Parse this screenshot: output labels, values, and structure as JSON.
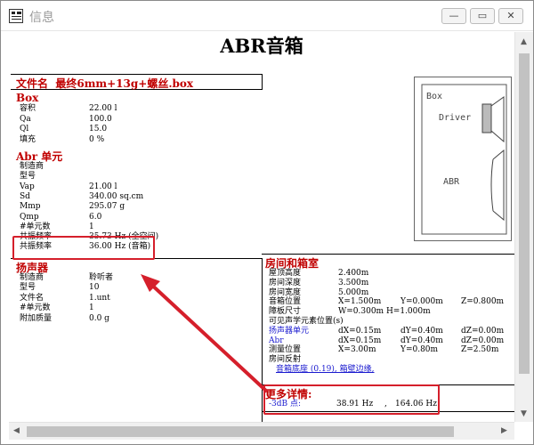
{
  "window": {
    "title": "信息"
  },
  "window_buttons": {
    "minimize": "—",
    "maximize": "▭",
    "close": "✕"
  },
  "doc": {
    "title": "ABR音箱"
  },
  "file": {
    "label": "文件名",
    "value": "最终6mm+13g+螺丝.box"
  },
  "box": {
    "heading": "Box",
    "rows": [
      {
        "label": "容积",
        "value": "22.00 l"
      },
      {
        "label": "Qa",
        "value": "100.0"
      },
      {
        "label": "Ql",
        "value": "15.0"
      },
      {
        "label": "填充",
        "value": "0 %"
      }
    ]
  },
  "abr": {
    "heading": "Abr 单元",
    "rows": [
      {
        "label": "制造商",
        "value": ""
      },
      {
        "label": "型号",
        "value": ""
      },
      {
        "label": "Vap",
        "value": "21.00 l"
      },
      {
        "label": "Sd",
        "value": "340.00 sq.cm"
      },
      {
        "label": "Mmp",
        "value": "295.07 g"
      },
      {
        "label": "Qmp",
        "value": "6.0"
      },
      {
        "label": "#单元数",
        "value": "1"
      },
      {
        "label": "共振频率",
        "value": "35.73 Hz (全空间)"
      },
      {
        "label": "共振频率",
        "value": "36.00 Hz (音箱)"
      }
    ]
  },
  "speaker": {
    "heading": "扬声器",
    "rows": [
      {
        "label": "制造商",
        "value": "聆听者"
      },
      {
        "label": "型号",
        "value": "10"
      },
      {
        "label": "文件名",
        "value": "1.unt"
      },
      {
        "label": "#单元数",
        "value": "1"
      },
      {
        "label": "附加质量",
        "value": "0.0 g"
      }
    ]
  },
  "room": {
    "heading": "房间和箱室",
    "rows": [
      {
        "label": "屋顶高度",
        "c1": "2.400m",
        "c2": "",
        "c3": ""
      },
      {
        "label": "房间深度",
        "c1": "3.500m",
        "c2": "",
        "c3": ""
      },
      {
        "label": "房间宽度",
        "c1": "5.000m",
        "c2": "",
        "c3": ""
      },
      {
        "label": "音箱位置",
        "c1": "X=1.500m",
        "c2": "Y=0.000m",
        "c3": "Z=0.800m"
      },
      {
        "label": "障板尺寸",
        "c1": "W=0.300m  H=1.000m",
        "c2": "",
        "c3": ""
      }
    ],
    "visible_label": "可见声学元素位置(s)",
    "elements": [
      {
        "label": "扬声器单元",
        "c1": "dX=0.15m",
        "c2": "dY=0.40m",
        "c3": "dZ=0.00m"
      },
      {
        "label": "Abr",
        "c1": "dX=0.15m",
        "c2": "dY=0.40m",
        "c3": "dZ=0.00m"
      }
    ],
    "mic": {
      "label": "测量位置",
      "c1": "X=3.00m",
      "c2": "Y=0.80m",
      "c3": "Z=2.50m"
    },
    "reflect_label": "房间反射",
    "reflect_detail": "音箱底座 (0.19),  箱壁边缘,"
  },
  "more": {
    "heading": "更多详情:",
    "label": "-3dB 点:",
    "value1": "38.91 Hz",
    "sep": ",",
    "value2": "164.06 Hz"
  },
  "diagram": {
    "box_label": "Box",
    "driver_label": "Driver",
    "abr_label": "ABR"
  },
  "colors": {
    "section_heading": "#c00000",
    "annotation": "#d51f2b",
    "link_text": "#1a1acf"
  }
}
